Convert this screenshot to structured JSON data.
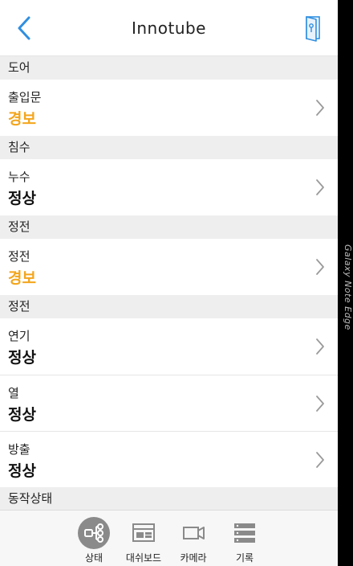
{
  "header": {
    "title": "Innotube",
    "back_icon": "chevron-left-icon",
    "door_icon": "door-icon",
    "accent_color": "#2f8fe0"
  },
  "sections": [
    {
      "title": "도어",
      "items": [
        {
          "name": "출입문",
          "status": "경보",
          "alarm": true
        }
      ]
    },
    {
      "title": "침수",
      "items": [
        {
          "name": "누수",
          "status": "정상",
          "alarm": false
        }
      ]
    },
    {
      "title": "정전",
      "items": [
        {
          "name": "정전",
          "status": "경보",
          "alarm": true
        }
      ]
    },
    {
      "title": "정전",
      "items": [
        {
          "name": "연기",
          "status": "정상",
          "alarm": false
        },
        {
          "name": "열",
          "status": "정상",
          "alarm": false
        },
        {
          "name": "방출",
          "status": "정상",
          "alarm": false
        }
      ]
    },
    {
      "title": "동작상태",
      "items": []
    }
  ],
  "colors": {
    "alarm": "#f3a51c",
    "normal": "#111111",
    "section_bg": "#eeeeee"
  },
  "bottom_nav": [
    {
      "label": "상태",
      "icon": "network-icon",
      "active": true
    },
    {
      "label": "대쉬보드",
      "icon": "dashboard-icon",
      "active": false
    },
    {
      "label": "카메라",
      "icon": "camera-icon",
      "active": false
    },
    {
      "label": "기록",
      "icon": "list-icon",
      "active": false
    }
  ],
  "device_edge": {
    "label": "Galaxy Note Edge"
  }
}
